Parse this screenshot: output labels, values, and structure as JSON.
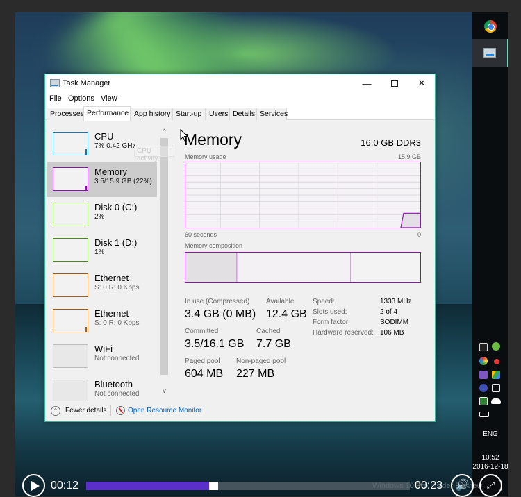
{
  "window": {
    "title": "Task Manager",
    "controls": {
      "minimize": "—",
      "maximize": "",
      "close": "✕"
    }
  },
  "menu": [
    "File",
    "Options",
    "View"
  ],
  "tabs": [
    {
      "label": "Processes",
      "active": false
    },
    {
      "label": "Performance",
      "active": true
    },
    {
      "label": "App history",
      "active": false
    },
    {
      "label": "Start-up",
      "active": false
    },
    {
      "label": "Users",
      "active": false
    },
    {
      "label": "Details",
      "active": false
    },
    {
      "label": "Services",
      "active": false
    }
  ],
  "sidebar": {
    "tooltip": "CPU activity",
    "items": [
      {
        "name": "CPU",
        "sub": "7% 0.42 GHz",
        "color": "#1279b8",
        "selected": false
      },
      {
        "name": "Memory",
        "sub": "3.5/15.9 GB (22%)",
        "color": "#8b12ae",
        "selected": true
      },
      {
        "name": "Disk 0 (C:)",
        "sub": "2%",
        "color": "#4c8a14",
        "selected": false
      },
      {
        "name": "Disk 1 (D:)",
        "sub": "1%",
        "color": "#4c8a14",
        "selected": false
      },
      {
        "name": "Ethernet",
        "sub": "S: 0 R: 0 Kbps",
        "color": "#a75a0c",
        "selected": false
      },
      {
        "name": "Ethernet",
        "sub": "S: 0 R: 0 Kbps",
        "color": "#a75a0c",
        "selected": false
      },
      {
        "name": "WiFi",
        "sub": "Not connected",
        "color": "#bdbdbd",
        "selected": false
      },
      {
        "name": "Bluetooth",
        "sub": "Not connected",
        "color": "#bdbdbd",
        "selected": false
      }
    ],
    "scroll_up": "^",
    "scroll_down": "v"
  },
  "main": {
    "title": "Memory",
    "spec": "16.0 GB DDR3",
    "usage_label": "Memory usage",
    "usage_max": "15.9 GB",
    "axis_left": "60 seconds",
    "axis_right": "0",
    "usage_fraction_recent": 0.22,
    "composition_label": "Memory composition",
    "composition": {
      "in_use_fraction": 0.22,
      "modified_fraction": 0.005,
      "standby_fraction": 0.48,
      "free_fraction": 0.295
    },
    "stats": {
      "in_use_label": "In use (Compressed)",
      "in_use_value": "3.4 GB (0 MB)",
      "available_label": "Available",
      "available_value": "12.4 GB",
      "committed_label": "Committed",
      "committed_value": "3.5/16.1 GB",
      "cached_label": "Cached",
      "cached_value": "7.7 GB",
      "paged_label": "Paged pool",
      "paged_value": "604 MB",
      "nonpaged_label": "Non-paged pool",
      "nonpaged_value": "227 MB"
    },
    "specs": [
      {
        "label": "Speed:",
        "value": "1333 MHz"
      },
      {
        "label": "Slots used:",
        "value": "2 of 4"
      },
      {
        "label": "Form factor:",
        "value": "SODIMM"
      },
      {
        "label": "Hardware reserved:",
        "value": "106 MB"
      }
    ]
  },
  "footer": {
    "fewer_details": "Fewer details",
    "resource_monitor": "Open Resource Monitor"
  },
  "taskbar": {
    "apps": [
      "chrome-icon",
      "task-manager-icon"
    ],
    "tray_icons": [
      "app-square-icon",
      "utorrent-icon",
      "color-app-icon",
      "record-icon",
      "onenote-icon",
      "google-drive-icon",
      "scansnap-icon",
      "sync-icon",
      "check-app-icon",
      "onedrive-icon",
      "battery-icon"
    ],
    "language": "ENG",
    "time": "10:52",
    "date": "2016-12-18"
  },
  "watermark": "Windows 10 Pro Insider Preview",
  "video": {
    "elapsed": "00:12",
    "remaining": "00:23",
    "progress": 0.38,
    "accent": "#5b2fc9"
  }
}
